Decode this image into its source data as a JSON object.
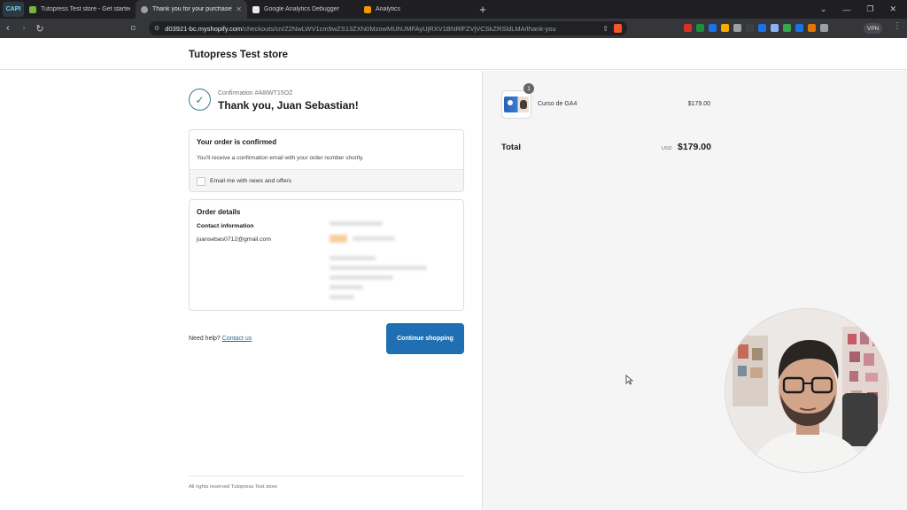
{
  "browser": {
    "window_badge": "CAPI",
    "tabs": [
      {
        "title": "Tutopress Test store - Get started with",
        "icon_color": "#7bb342",
        "icon": "shopify-icon"
      },
      {
        "title": "Thank you for your purchase! -",
        "icon_color": "#9aa0a6",
        "icon": "globe-icon"
      },
      {
        "title": "Google Analytics Debugger",
        "icon_color": "#e8eaed",
        "icon": "extension-icon"
      },
      {
        "title": "Analytics",
        "icon_color": "#f29900",
        "icon": "analytics-icon"
      }
    ],
    "new_tab_label": "+",
    "url_host": "d03921-bc.myshopify.com",
    "url_path": "/checkouts/cn/Z2NwLWV1cm9wZS13ZXN0MzowMUhUMFAyUjRXV1BNRlFZVjVCSkZRSldLMA/thank-you",
    "vpn_label": "VPN",
    "extension_colors": [
      "#d93025",
      "#1e8e3e",
      "#1a73e8",
      "#f9ab00",
      "#9aa0a6",
      "#3c4043",
      "#1a73e8",
      "#8ab4f8",
      "#34a853",
      "#1a73e8",
      "#e37400",
      "#9aa0a6"
    ]
  },
  "store": {
    "name": "Tutopress Test store"
  },
  "confirmation": {
    "number": "Confirmation #A8IWT15OZ",
    "thanks": "Thank you, Juan Sebastian!",
    "accent_color": "#2f7b8f"
  },
  "confirmed_card": {
    "title": "Your order is confirmed",
    "text": "You'll receive a confirmation email with your order number shortly.",
    "checkbox_label": "Email me with news and offers"
  },
  "order_details": {
    "title": "Order details",
    "contact_label": "Contact information",
    "email": "juansebas0712@gmail.com"
  },
  "help": {
    "text": "Need help?",
    "link": "Contact us"
  },
  "continue_button": {
    "label": "Continue shopping",
    "color": "#1f6fb2"
  },
  "footer": {
    "text": "All rights reserved Tutopress Test store"
  },
  "summary": {
    "item": {
      "quantity": "1",
      "name": "Curso de GA4",
      "price": "$179.00"
    },
    "total_label": "Total",
    "total_currency": "USD",
    "total_value": "$179.00"
  }
}
